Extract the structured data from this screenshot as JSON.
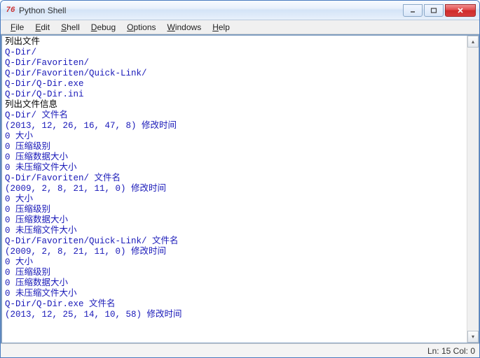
{
  "window": {
    "icon_text": "76",
    "title": "Python Shell"
  },
  "menu": {
    "items": [
      {
        "pre": "",
        "key": "F",
        "post": "ile"
      },
      {
        "pre": "",
        "key": "E",
        "post": "dit"
      },
      {
        "pre": "",
        "key": "S",
        "post": "hell"
      },
      {
        "pre": "",
        "key": "D",
        "post": "ebug"
      },
      {
        "pre": "",
        "key": "O",
        "post": "ptions"
      },
      {
        "pre": "",
        "key": "W",
        "post": "indows"
      },
      {
        "pre": "",
        "key": "H",
        "post": "elp"
      }
    ]
  },
  "output": {
    "lines": [
      {
        "t": "列出文件",
        "c": "black"
      },
      {
        "t": "Q-Dir/",
        "c": "blue"
      },
      {
        "t": "Q-Dir/Favoriten/",
        "c": "blue"
      },
      {
        "t": "Q-Dir/Favoriten/Quick-Link/",
        "c": "blue"
      },
      {
        "t": "Q-Dir/Q-Dir.exe",
        "c": "blue"
      },
      {
        "t": "Q-Dir/Q-Dir.ini",
        "c": "blue"
      },
      {
        "t": "列出文件信息",
        "c": "black"
      },
      {
        "t": "Q-Dir/ 文件名",
        "c": "blue"
      },
      {
        "t": "(2013, 12, 26, 16, 47, 8) 修改时间",
        "c": "blue"
      },
      {
        "t": "0 大小",
        "c": "blue"
      },
      {
        "t": "0 压缩级别",
        "c": "blue"
      },
      {
        "t": "0 压缩数据大小",
        "c": "blue"
      },
      {
        "t": "0 未压缩文件大小",
        "c": "blue"
      },
      {
        "t": "Q-Dir/Favoriten/ 文件名",
        "c": "blue"
      },
      {
        "t": "(2009, 2, 8, 21, 11, 0) 修改时间",
        "c": "blue"
      },
      {
        "t": "0 大小",
        "c": "blue"
      },
      {
        "t": "0 压缩级别",
        "c": "blue"
      },
      {
        "t": "0 压缩数据大小",
        "c": "blue"
      },
      {
        "t": "0 未压缩文件大小",
        "c": "blue"
      },
      {
        "t": "Q-Dir/Favoriten/Quick-Link/ 文件名",
        "c": "blue"
      },
      {
        "t": "(2009, 2, 8, 21, 11, 0) 修改时间",
        "c": "blue"
      },
      {
        "t": "0 大小",
        "c": "blue"
      },
      {
        "t": "0 压缩级别",
        "c": "blue"
      },
      {
        "t": "0 压缩数据大小",
        "c": "blue"
      },
      {
        "t": "0 未压缩文件大小",
        "c": "blue"
      },
      {
        "t": "Q-Dir/Q-Dir.exe 文件名",
        "c": "blue"
      },
      {
        "t": "(2013, 12, 25, 14, 10, 58) 修改时间",
        "c": "blue"
      }
    ]
  },
  "status": {
    "line_col": "Ln: 15 Col: 0"
  }
}
